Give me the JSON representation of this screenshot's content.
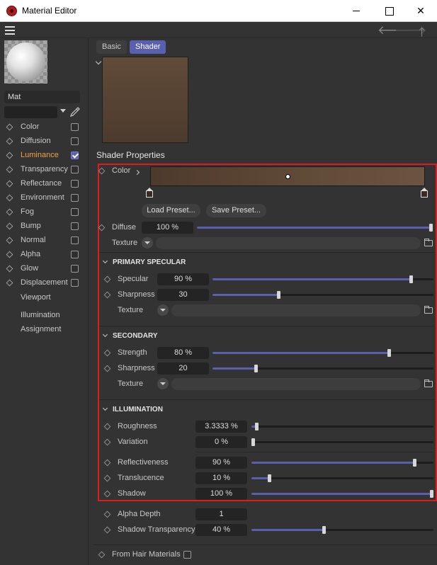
{
  "window": {
    "title": "Material Editor"
  },
  "left": {
    "material_name": "Mat",
    "channels": [
      {
        "label": "Color",
        "checked": false,
        "active": false
      },
      {
        "label": "Diffusion",
        "checked": false,
        "active": false
      },
      {
        "label": "Luminance",
        "checked": true,
        "active": true
      },
      {
        "label": "Transparency",
        "checked": false,
        "active": false
      },
      {
        "label": "Reflectance",
        "checked": false,
        "active": false
      },
      {
        "label": "Environment",
        "checked": false,
        "active": false
      },
      {
        "label": "Fog",
        "checked": false,
        "active": false
      },
      {
        "label": "Bump",
        "checked": false,
        "active": false
      },
      {
        "label": "Normal",
        "checked": false,
        "active": false
      },
      {
        "label": "Alpha",
        "checked": false,
        "active": false
      },
      {
        "label": "Glow",
        "checked": false,
        "active": false
      },
      {
        "label": "Displacement",
        "checked": false,
        "active": false
      }
    ],
    "extra_items": [
      "Viewport",
      "Illumination",
      "Assignment"
    ]
  },
  "tabs": {
    "basic": "Basic",
    "shader": "Shader"
  },
  "shader": {
    "section_title": "Shader Properties",
    "color_label": "Color",
    "load_preset": "Load Preset...",
    "save_preset": "Save Preset...",
    "diffuse": {
      "label": "Diffuse",
      "value": "100 %",
      "level": 1.0
    },
    "texture_label": "Texture",
    "primary_specular": {
      "title": "PRIMARY SPECULAR",
      "specular": {
        "label": "Specular",
        "value": "90 %",
        "level": 0.9
      },
      "sharpness": {
        "label": "Sharpness",
        "value": "30",
        "level": 0.3
      },
      "texture_label": "Texture"
    },
    "secondary": {
      "title": "SECONDARY",
      "strength": {
        "label": "Strength",
        "value": "80 %",
        "level": 0.8
      },
      "sharpness": {
        "label": "Sharpness",
        "value": "20",
        "level": 0.2
      },
      "texture_label": "Texture"
    },
    "illumination": {
      "title": "ILLUMINATION",
      "roughness": {
        "label": "Roughness",
        "value": "3.3333 %",
        "level": 0.033
      },
      "variation": {
        "label": "Variation",
        "value": "0 %",
        "level": 0.0
      },
      "reflectiveness": {
        "label": "Reflectiveness",
        "value": "90 %",
        "level": 0.9
      },
      "translucence": {
        "label": "Translucence",
        "value": "10 %",
        "level": 0.1
      },
      "shadow": {
        "label": "Shadow",
        "value": "100 %",
        "level": 1.0
      }
    },
    "alpha_depth": {
      "label": "Alpha Depth",
      "value": "1"
    },
    "shadow_transparency": {
      "label": "Shadow Transparency",
      "value": "40 %",
      "level": 0.4
    },
    "from_hair": {
      "label": "From Hair Materials",
      "checked": false
    }
  },
  "colors": {
    "accent": "#5a5fae",
    "active_channel": "#f0a145",
    "highlight_box": "#e01b1b",
    "shader_color": "#614b39"
  },
  "icons": [
    "app-icon",
    "hamburger-icon",
    "back-arrow-icon",
    "forward-arrow-icon",
    "up-arrow-icon",
    "eyedropper-icon",
    "folder-icon"
  ]
}
